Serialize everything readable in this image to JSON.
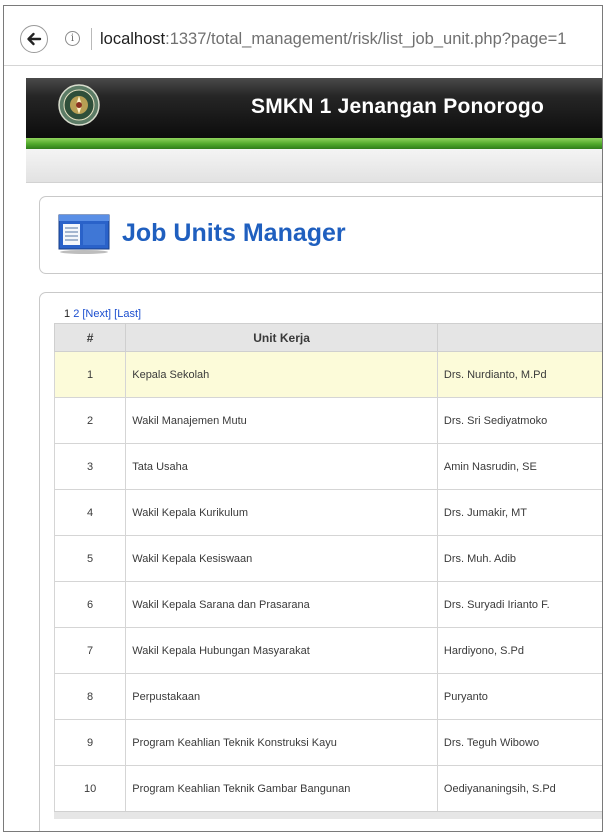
{
  "browser": {
    "url_host": "localhost",
    "url_rest": ":1337/total_management/risk/list_job_unit.php?page=1"
  },
  "header": {
    "title": "SMKN 1 Jenangan Ponorogo"
  },
  "page": {
    "title": "Job Units Manager"
  },
  "pager": {
    "current": "1",
    "page2": "2",
    "next": "[Next]",
    "last": "[Last]"
  },
  "table": {
    "columns": [
      "#",
      "Unit Kerja",
      ""
    ],
    "rows": [
      {
        "no": "1",
        "unit": "Kepala Sekolah",
        "name": "Drs. Nurdianto, M.Pd"
      },
      {
        "no": "2",
        "unit": "Wakil Manajemen Mutu",
        "name": "Drs. Sri Sediyatmoko"
      },
      {
        "no": "3",
        "unit": "Tata Usaha",
        "name": "Amin Nasrudin, SE"
      },
      {
        "no": "4",
        "unit": "Wakil Kepala Kurikulum",
        "name": "Drs. Jumakir, MT"
      },
      {
        "no": "5",
        "unit": "Wakil Kepala Kesiswaan",
        "name": "Drs. Muh. Adib"
      },
      {
        "no": "6",
        "unit": "Wakil Kepala Sarana dan Prasarana",
        "name": "Drs. Suryadi Irianto F."
      },
      {
        "no": "7",
        "unit": "Wakil Kepala Hubungan Masyarakat",
        "name": "Hardiyono, S.Pd"
      },
      {
        "no": "8",
        "unit": "Perpustakaan",
        "name": "Puryanto"
      },
      {
        "no": "9",
        "unit": "Program Keahlian Teknik Konstruksi Kayu",
        "name": "Drs. Teguh Wibowo"
      },
      {
        "no": "10",
        "unit": "Program Keahlian Teknik Gambar Bangunan",
        "name": "Oediyananingsih, S.Pd"
      }
    ]
  },
  "colors": {
    "header_bg": "#1a1a1a",
    "stripe_green": "#4fa82a",
    "title_blue": "#1f5fbf",
    "highlight_row": "#fcfbd9"
  },
  "icons": {
    "back": "back-arrow-icon",
    "info": "info-icon",
    "logo": "school-logo",
    "title": "window-list-icon"
  }
}
